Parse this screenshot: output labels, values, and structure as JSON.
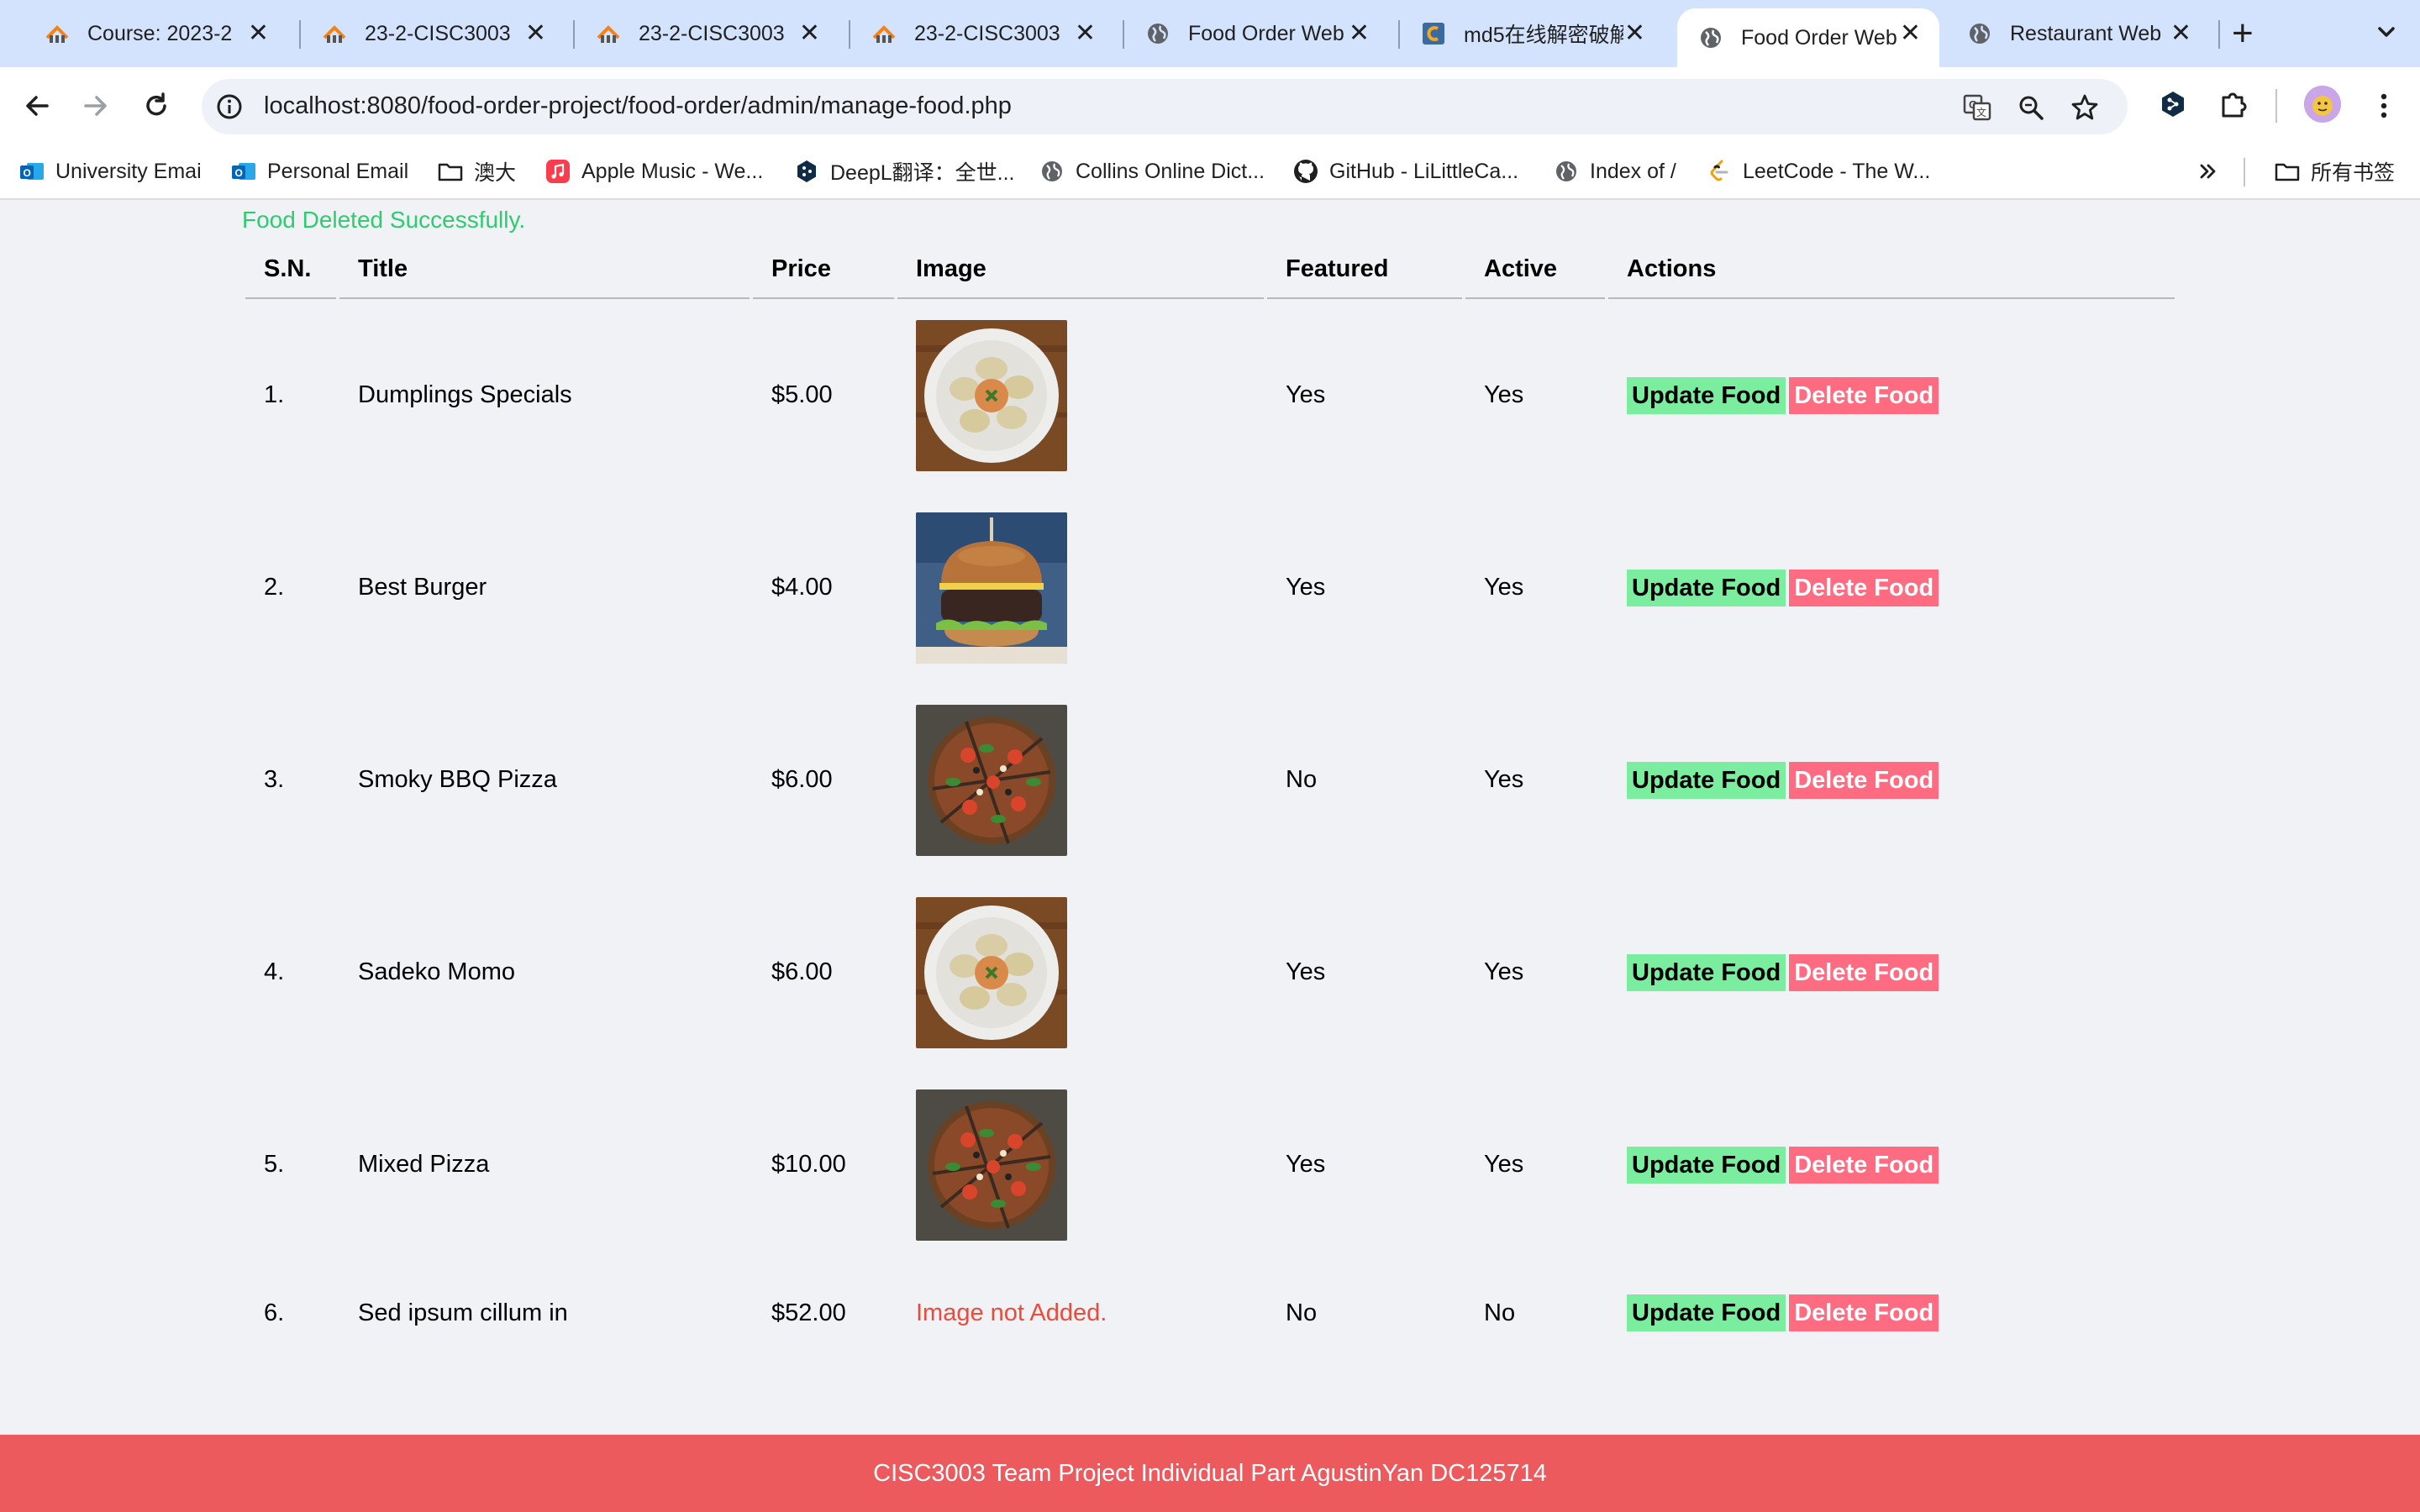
{
  "browser": {
    "tabs": [
      {
        "title": "Course: 2023-2",
        "icon": "moodle-icon"
      },
      {
        "title": "23-2-CISC3003",
        "icon": "moodle-icon"
      },
      {
        "title": "23-2-CISC3003",
        "icon": "moodle-icon"
      },
      {
        "title": "23-2-CISC3003",
        "icon": "moodle-icon"
      },
      {
        "title": "Food Order Web",
        "icon": "globe-icon"
      },
      {
        "title": "md5在线解密破解",
        "icon": "cmd5-icon"
      },
      {
        "title": "Food Order Web",
        "icon": "globe-icon",
        "active": true
      },
      {
        "title": "Restaurant Web",
        "icon": "globe-icon"
      }
    ],
    "url": "localhost:8080/food-order-project/food-order/admin/manage-food.php",
    "bookmarks": [
      {
        "label": "University Emai",
        "icon": "outlook-icon"
      },
      {
        "label": "Personal Email",
        "icon": "outlook-icon"
      },
      {
        "label": "澳大",
        "icon": "folder-icon"
      },
      {
        "label": "Apple Music - We...",
        "icon": "apple-music-icon"
      },
      {
        "label": "DeepL翻译：全世...",
        "icon": "deepl-icon"
      },
      {
        "label": "Collins Online Dict...",
        "icon": "globe-icon"
      },
      {
        "label": "GitHub - LiLittleCa...",
        "icon": "github-icon"
      },
      {
        "label": "Index of /",
        "icon": "globe-icon"
      },
      {
        "label": "LeetCode - The W...",
        "icon": "leetcode-icon"
      }
    ],
    "bookmarks_folder": "所有书签"
  },
  "page": {
    "success_message": "Food Deleted Successfully.",
    "columns": [
      "S.N.",
      "Title",
      "Price",
      "Image",
      "Featured",
      "Active",
      "Actions"
    ],
    "rows": [
      {
        "sn": "1.",
        "title": "Dumplings Specials",
        "price": "$5.00",
        "image": "dumplings",
        "featured": "Yes",
        "active": "Yes"
      },
      {
        "sn": "2.",
        "title": "Best Burger",
        "price": "$4.00",
        "image": "burger",
        "featured": "Yes",
        "active": "Yes"
      },
      {
        "sn": "3.",
        "title": "Smoky BBQ Pizza",
        "price": "$6.00",
        "image": "pizza",
        "featured": "No",
        "active": "Yes"
      },
      {
        "sn": "4.",
        "title": "Sadeko Momo",
        "price": "$6.00",
        "image": "dumplings",
        "featured": "Yes",
        "active": "Yes"
      },
      {
        "sn": "5.",
        "title": "Mixed Pizza",
        "price": "$10.00",
        "image": "pizza",
        "featured": "Yes",
        "active": "Yes"
      },
      {
        "sn": "6.",
        "title": "Sed ipsum cillum in",
        "price": "$52.00",
        "image": "",
        "featured": "No",
        "active": "No"
      }
    ],
    "no_image_text": "Image not Added.",
    "update_label": "Update Food",
    "delete_label": "Delete Food",
    "footer": "CISC3003 Team Project Individual Part AgustinYan DC125714"
  },
  "colors": {
    "success": "#2ecc71",
    "update_button": "#7bed9f",
    "delete_button": "#ff6b81",
    "footer": "#ec5a5e",
    "error_text": "#e74c3c"
  }
}
